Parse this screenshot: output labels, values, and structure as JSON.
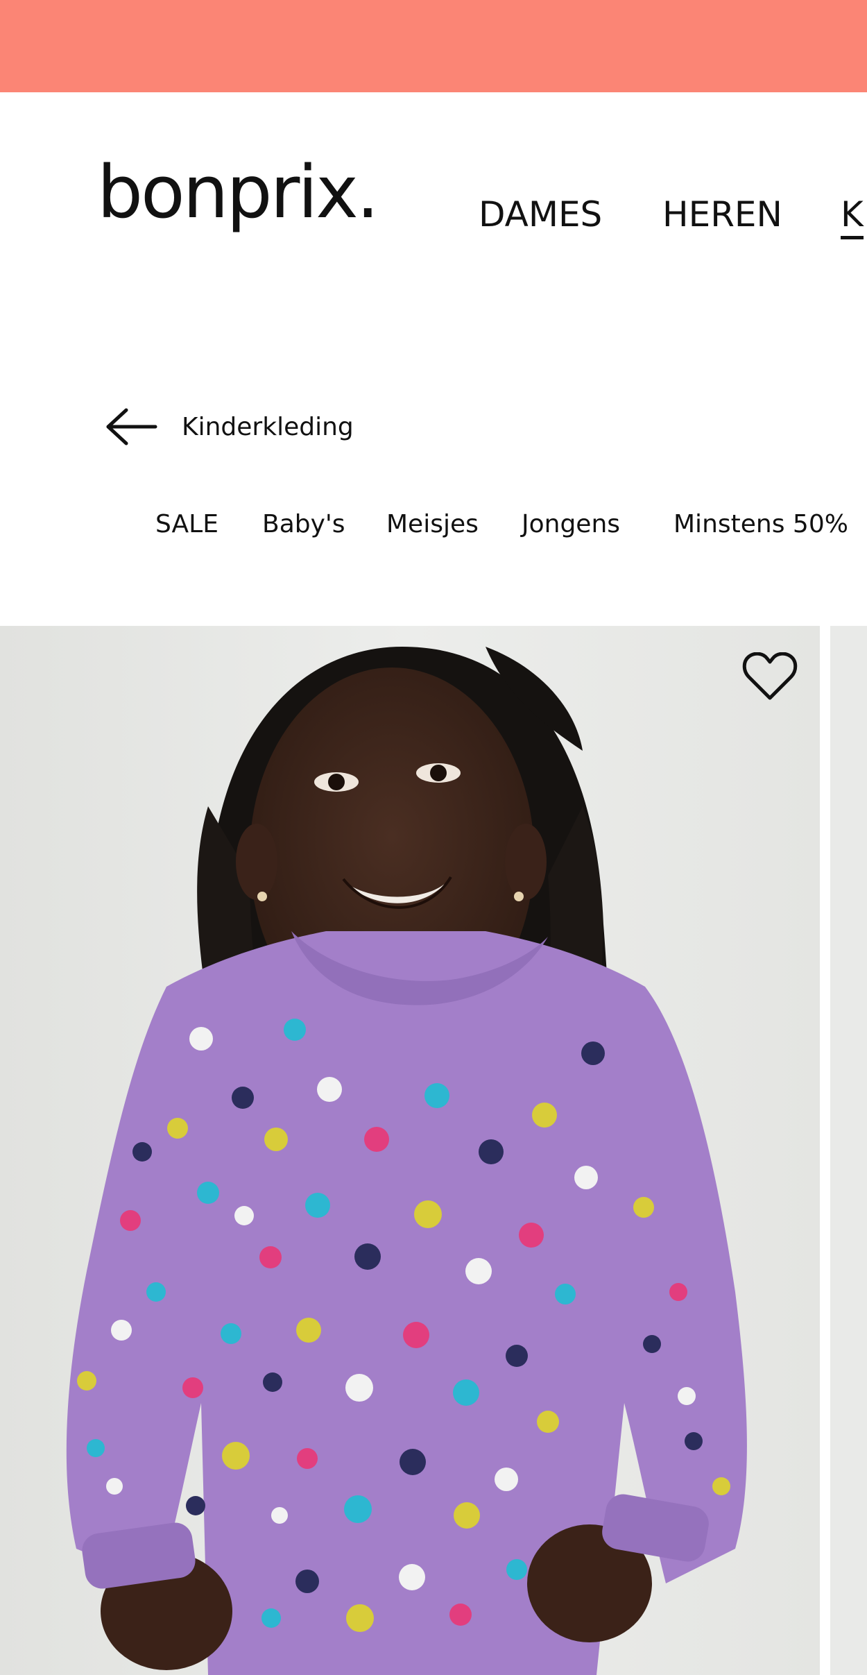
{
  "colors": {
    "promo_bar": "#fb8575",
    "text": "#111111",
    "sweater": "#a37fc9",
    "image_background": "#e8e9e7"
  },
  "header": {
    "logo_text": "bonprix.",
    "main_nav": [
      {
        "label": "DAMES"
      },
      {
        "label": "HEREN"
      },
      {
        "label": "K"
      }
    ]
  },
  "breadcrumb": {
    "back_icon": "arrow-left-icon",
    "back_label": "Kinderkleding"
  },
  "sub_nav": [
    {
      "label": "SALE"
    },
    {
      "label": "Baby's"
    },
    {
      "label": "Meisjes"
    },
    {
      "label": "Jongens"
    },
    {
      "label": "Minstens 50%"
    }
  ],
  "product": {
    "image_subject": "child-in-polka-dot-sweatshirt",
    "wishlist_icon": "heart-icon"
  }
}
